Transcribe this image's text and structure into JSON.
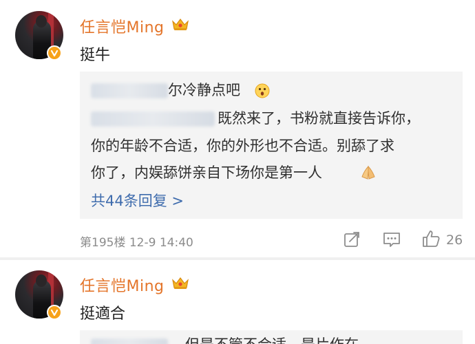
{
  "comments": [
    {
      "username": "任言恺Ming",
      "text": "挺牛",
      "reply": {
        "line1_suffix": "尔冷静点吧",
        "line2_suffix": "既然来了，书粉就直接告诉你，",
        "line3": "你的年龄不合适，你的外形也不合适。别舔了求",
        "line4": "你了，内娱舔饼亲自下场你是第一人",
        "more": "共44条回复 >"
      },
      "meta": "第195楼 12-9 14:40",
      "likes": "26"
    },
    {
      "username": "任言恺Ming",
      "text": "挺適合",
      "reply_partial": "，但是不管不合适，是片作在"
    }
  ],
  "icons": {
    "verified": "verified-badge-icon",
    "crown": "crown-vip-icon",
    "emoji_surprised": "surprised-emoji-icon",
    "emoji_pray": "pray-hands-emoji-icon",
    "share": "share-icon",
    "comment": "comment-icon",
    "like": "thumbs-up-icon"
  },
  "colors": {
    "username": "#e4752a",
    "link": "#3f6cad",
    "meta": "#8c8c8c",
    "reply_bg": "#f4f4f4",
    "badge": "#f7a21a"
  }
}
